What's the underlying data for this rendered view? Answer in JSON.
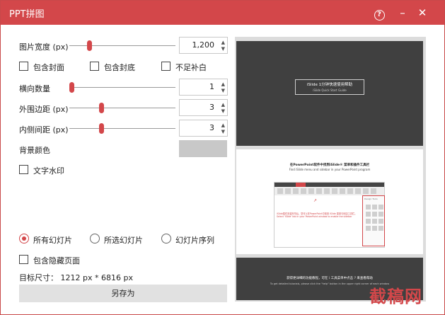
{
  "window": {
    "title": "PPT拼图",
    "help_glyph": "?",
    "minimize_glyph": "–",
    "close_glyph": "✕"
  },
  "settings": {
    "width": {
      "label": "图片宽度 (px)",
      "value": "1,200"
    },
    "include_cover": "包含封面",
    "include_back": "包含封底",
    "no_padding": "不足补白",
    "columns": {
      "label": "横向数量",
      "value": "1"
    },
    "outer_margin": {
      "label": "外围边距 (px)",
      "value": "3"
    },
    "inner_spacing": {
      "label": "内侧间距 (px)",
      "value": "3"
    },
    "bg_color": {
      "label": "背景颜色",
      "value": "#c8c8c8"
    },
    "text_watermark": "文字水印"
  },
  "scope": {
    "all_slides": "所有幻灯片",
    "selected_slides": "所选幻灯片",
    "slide_sequence": "幻灯片序列",
    "selected": "all_slides"
  },
  "include_hidden": "包含隐藏页面",
  "target_size": "目标尺寸： 1212 px * 6816 px",
  "save_button": "另存为",
  "preview": {
    "slide1_title": "iSlide 1分钟快速使用帮助",
    "slide1_subtitle": "iSlide Quick Start Guide",
    "slide2_title": "在PowerPoint软件中找到iSlide® 菜单和插件工具栏",
    "slide2_subtitle": "Find iSlide menu and sidebar in your PowerPoint program",
    "slide2_body": "iSlide插件安装完毕后，您可以在PowerPoint中找到 iSlide 菜单与侧边工具栏。Select 'iSlide' tab in your PowerPoint window to enable the sidebar",
    "slide2_pane_title": "Design Tools",
    "slide3_title": "获得更详细的功能教程，可在 i 工具菜单中点击 ? 来查看帮助",
    "slide3_subtitle": "To get detailed tutorials, please click the \"help\" button in the upper right corner of each window"
  },
  "site_watermark": "截稿网",
  "accent_color": "#d3474a"
}
